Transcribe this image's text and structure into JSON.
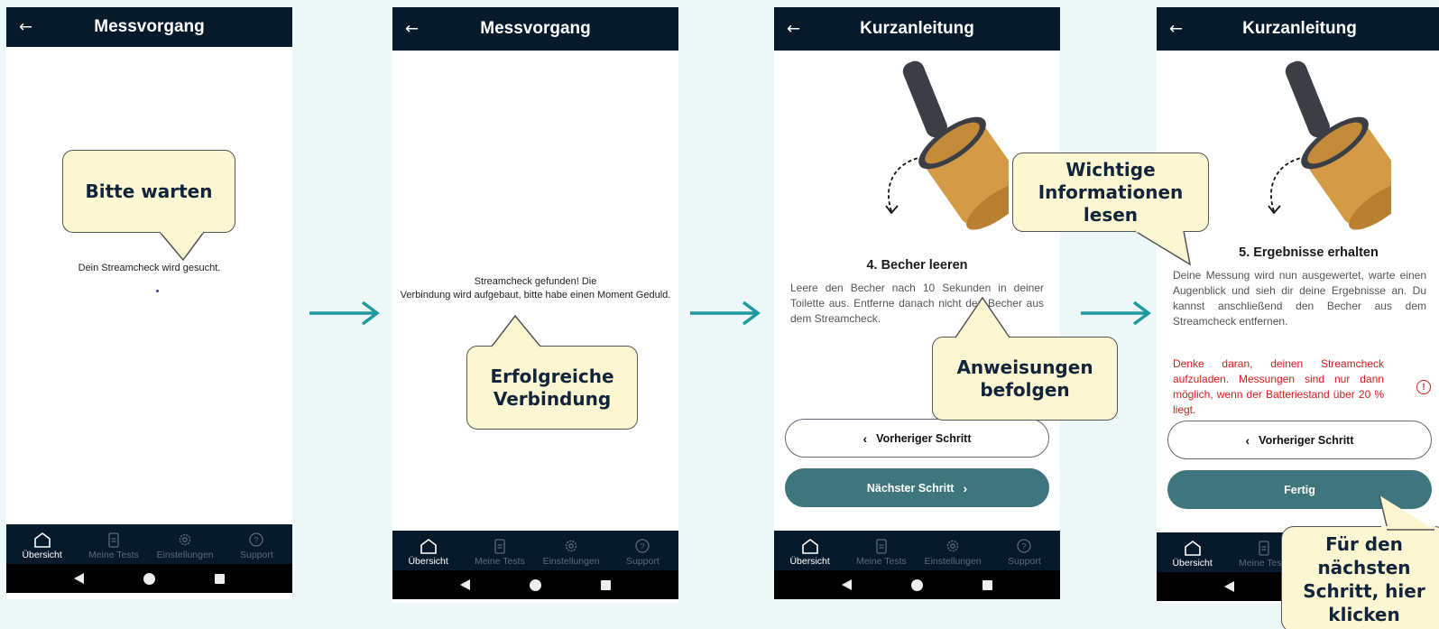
{
  "colors": {
    "appbar": "#071a2b",
    "accent": "#3f767d",
    "callout_bg": "#fdf6d3",
    "warning": "#d21b1b",
    "arrow": "#1e9aa0"
  },
  "icons": {
    "back": "arrow-left-icon",
    "flow_arrow": "arrow-right-icon",
    "nav_home": "home-icon",
    "nav_tests": "clipboard-icon",
    "nav_settings": "gear-icon",
    "nav_support": "help-icon",
    "warning": "alert-circle-icon"
  },
  "nav": {
    "items": [
      "Übersicht",
      "Meine Tests",
      "Einstellungen",
      "Support"
    ]
  },
  "screen1": {
    "title": "Messvorgang",
    "status": "Dein Streamcheck wird gesucht.",
    "callout": "Bitte warten"
  },
  "screen2": {
    "title": "Messvorgang",
    "status_line1": "Streamcheck gefunden! Die",
    "status_line2": "Verbindung wird aufgebaut, bitte habe einen Moment Geduld.",
    "callout_line1": "Erfolgreiche",
    "callout_line2": "Verbindung"
  },
  "screen3": {
    "title": "Kurzanleitung",
    "step_heading": "4. Becher leeren",
    "step_body": "Leere den Becher nach 10 Sekunden in deiner Toilette aus. Entferne danach nicht den Becher aus dem Streamcheck.",
    "prev_button": "Vorheriger Schritt",
    "next_button": "Nächster Schritt",
    "callout_line1": "Anweisungen",
    "callout_line2": "befolgen"
  },
  "screen4": {
    "title": "Kurzanleitung",
    "step_heading": "5. Ergebnisse erhalten",
    "step_body": "Deine Messung wird nun ausgewertet, warte einen Augenblick und sieh dir deine Ergebnisse an. Du kannst anschließend den Becher aus dem Streamcheck entfernen.",
    "warning": "Denke daran, deinen Streamcheck aufzuladen. Messungen sind nur dann möglich, wenn der Batteriestand über 20 % liegt.",
    "prev_button": "Vorheriger Schritt",
    "finish_button": "Fertig",
    "callout_info_line1": "Wichtige",
    "callout_info_line2": "Informationen",
    "callout_info_line3": "lesen",
    "callout_next_line1": "Für den",
    "callout_next_line2": "nächsten",
    "callout_next_line3": "Schritt, hier",
    "callout_next_line4": "klicken"
  }
}
